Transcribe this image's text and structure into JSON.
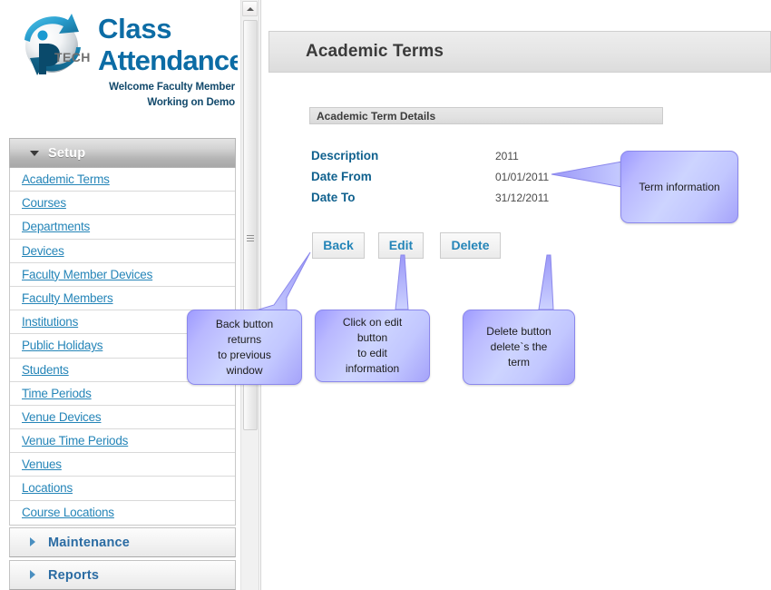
{
  "brand": {
    "logo_icon": "iptech-globe-logo",
    "title_line1": "Class",
    "title_line2": "Attendance",
    "welcome_line1": "Welcome Faculty Member",
    "welcome_line2": "Working on Demo",
    "title_color": "#0c6ca5"
  },
  "sidebar": {
    "groups": [
      {
        "label": "Setup",
        "state": "expanded",
        "icon": "chevron-down-icon"
      },
      {
        "label": "Maintenance",
        "state": "collapsed",
        "icon": "chevron-right-icon"
      },
      {
        "label": "Reports",
        "state": "collapsed",
        "icon": "chevron-right-icon"
      }
    ],
    "items": [
      {
        "label": "Academic Terms"
      },
      {
        "label": "Courses"
      },
      {
        "label": "Departments"
      },
      {
        "label": "Devices"
      },
      {
        "label": "Faculty Member Devices"
      },
      {
        "label": "Faculty Members"
      },
      {
        "label": "Institutions"
      },
      {
        "label": "Public Holidays"
      },
      {
        "label": "Students"
      },
      {
        "label": "Time Periods"
      },
      {
        "label": "Venue Devices"
      },
      {
        "label": "Venue Time Periods"
      },
      {
        "label": "Venues"
      },
      {
        "label": "Locations"
      },
      {
        "label": "Course Locations"
      }
    ],
    "link_color": "#2585b8"
  },
  "scrollbar": {
    "up_icon": "scroll-up-arrow-icon",
    "grip_icon": "scroll-grip-icon"
  },
  "main": {
    "page_title": "Academic Terms",
    "section_header": "Academic Term Details",
    "fields": [
      {
        "label": "Description",
        "value": "2011"
      },
      {
        "label": "Date From",
        "value": "01/01/2011"
      },
      {
        "label": "Date To",
        "value": "31/12/2011"
      }
    ],
    "buttons": [
      {
        "label": "Back"
      },
      {
        "label": "Edit"
      },
      {
        "label": "Delete"
      }
    ]
  },
  "callouts": {
    "term": "Term information",
    "back_line1": "Back button returns",
    "back_line2": "to previous window",
    "edit_line1": "Click on edit button",
    "edit_line2": "to edit information",
    "delete_line1": "Delete button",
    "delete_line2": "delete`s the term",
    "fill_color": "#c2c7ff",
    "border_color": "#8b88ec"
  }
}
